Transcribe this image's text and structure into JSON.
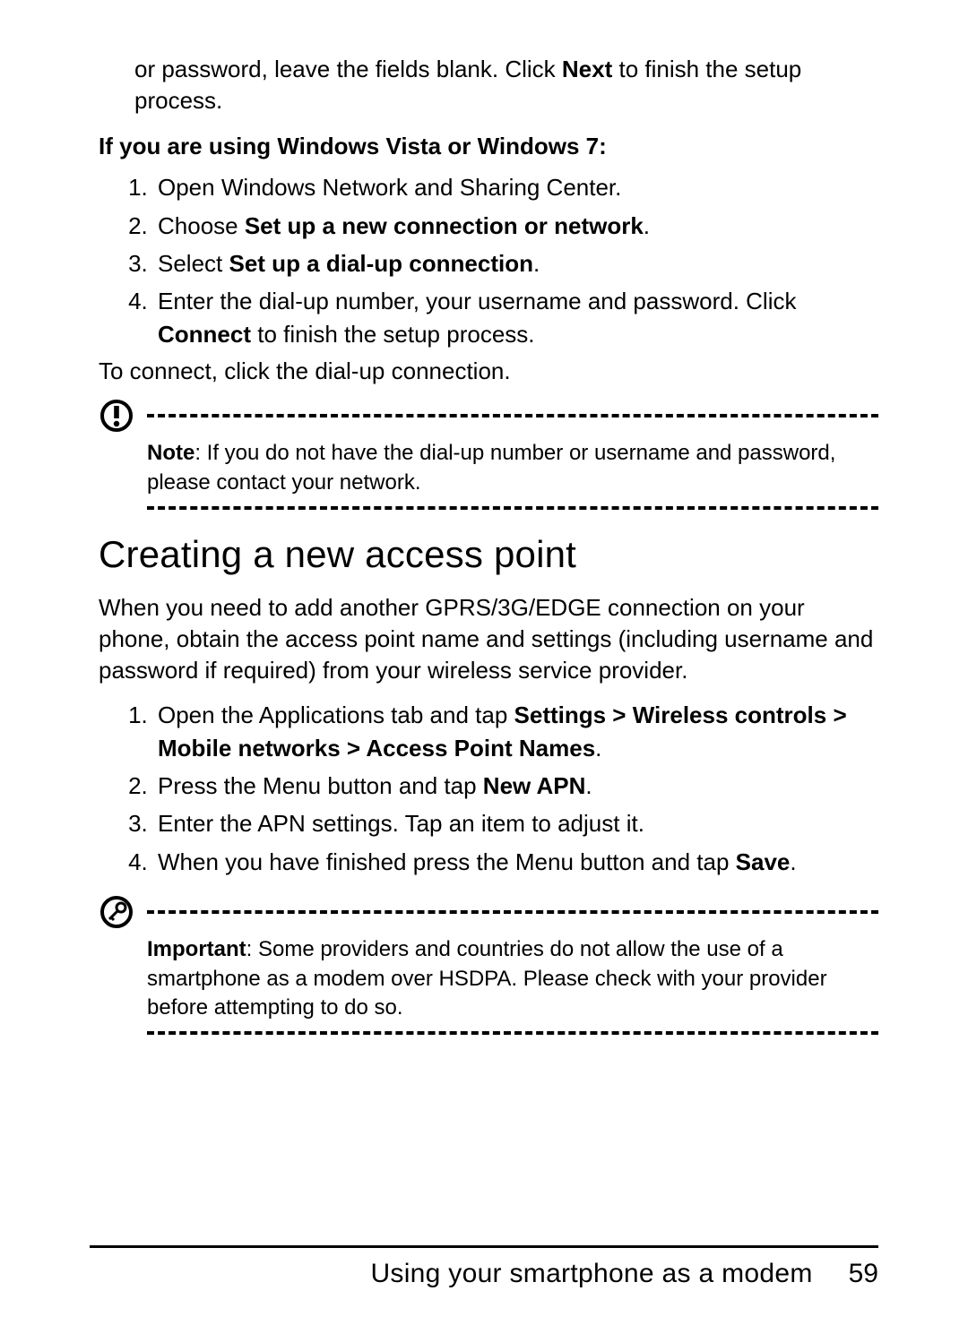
{
  "intro_prefix": "or password, leave the fields blank. Click ",
  "intro_bold": "Next",
  "intro_suffix": " to finish the setup process.",
  "vista_heading": "If you are using Windows Vista or Windows 7:",
  "vista_steps": {
    "s1": "Open Windows Network and Sharing Center.",
    "s2_pre": "Choose ",
    "s2_b": "Set up a new connection or network",
    "s2_post": ".",
    "s3_pre": "Select ",
    "s3_b": "Set up a dial-up connection",
    "s3_post": ".",
    "s4_pre": "Enter the dial-up number, your username and password. Click ",
    "s4_b": "Connect",
    "s4_post": " to finish the setup process."
  },
  "connect_line": "To connect, click the dial-up connection.",
  "note_label": "Note",
  "note_body": ": If you do not have the dial-up number or username and password, please contact your network.",
  "section_heading": "Creating a new access point",
  "section_intro": "When you need to add another GPRS/3G/EDGE connection on your phone, obtain the access point name and settings (including username and password if required) from your wireless service provider.",
  "apn_steps": {
    "s1_pre": "Open the Applications tab and tap ",
    "s1_b": "Settings > Wireless controls > Mobile networks > Access Point Names",
    "s1_post": ".",
    "s2_pre": "Press the Menu button and tap ",
    "s2_b": "New APN",
    "s2_post": ".",
    "s3": "Enter the APN settings. Tap an item to adjust it.",
    "s4_pre": "When you have finished press the Menu button and tap ",
    "s4_b": "Save",
    "s4_post": "."
  },
  "important_label": "Important",
  "important_body": ": Some providers and countries do not allow the use of a smartphone as a modem over HSDPA. Please check with your provider before attempting to do so.",
  "footer_title": "Using your smartphone as a modem",
  "footer_page": "59"
}
